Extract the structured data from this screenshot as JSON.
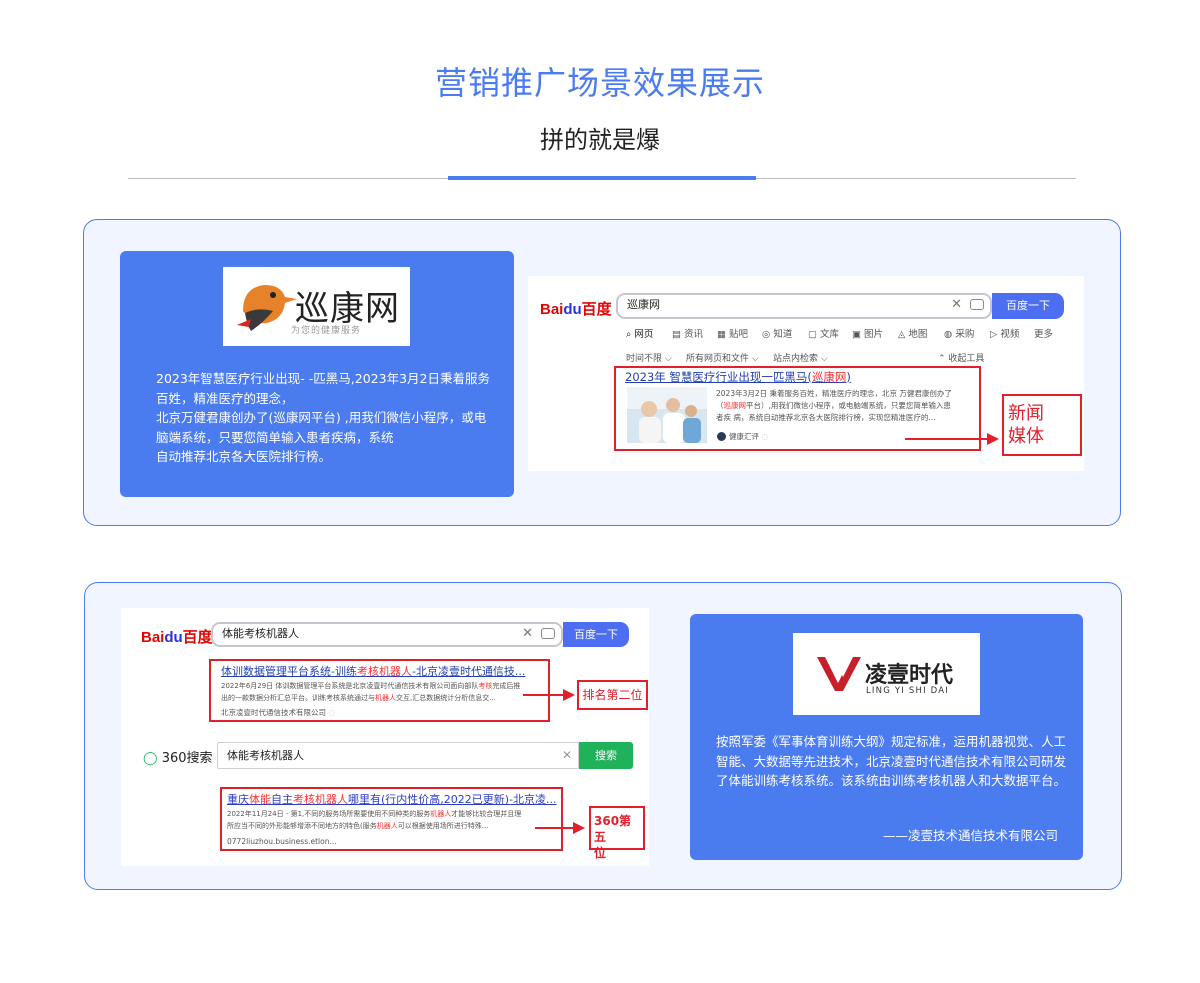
{
  "header": {
    "title": "营销推广场景效果展示",
    "subtitle": "拼的就是爆"
  },
  "case1": {
    "logo_text": "巡康网",
    "logo_slogan": "为您的健康服务",
    "desc_lines": [
      "2023年智慧医疗行业出现- -匹黑马,2023年3月2日秉着服务",
      "百姓，精准医疗的理念，",
      "北京万健君康创办了(巡康网平台) ,用我们微信小程序，或电",
      "脑端系统，只要您简单输入患者疾病，系统",
      "自动推荐北京各大医院排行榜。"
    ],
    "screenshot": {
      "engine_logo_a": "Bai",
      "engine_logo_b": "du",
      "engine_logo_c": "百度",
      "query": "巡康网",
      "search_button": "百度一下",
      "tabs": [
        "网页",
        "资讯",
        "贴吧",
        "知道",
        "文库",
        "图片",
        "地图",
        "采购",
        "视频",
        "更多"
      ],
      "filters": [
        "时间不限",
        "所有网页和文件",
        "站点内检索"
      ],
      "tools": "收起工具",
      "result_title_a": "2023年 智慧医疗行业出现一匹黑马(",
      "result_title_hl": "巡康网",
      "result_title_b": ")",
      "snippet_l1": "2023年3月2日 秉着服务百姓，精准医疗的理念，北京 万健君康创办了",
      "snippet_l2a": "（",
      "snippet_l2hl": "巡康网",
      "snippet_l2b": "平台）,用我们微信小程序，或电脑端系统，只要您简单输入患",
      "snippet_l3": "者疾 病，系统自动推荐北京各大医院排行榜，实现您精准医疗的...",
      "source": "健康汇评",
      "label": "新闻媒体",
      "label_l1": "新闻",
      "label_l2": "媒体"
    }
  },
  "case2": {
    "logo_text": "凌壹时代",
    "logo_sub": "LING YI SHI DAI",
    "desc_lines": [
      "按照军委《军事体育训练大纲》规定标准，运用机器视觉、人工",
      "智能、大数据等先进技术，北京凌壹时代通信技术有限公司研发",
      "了体能训练考核系统。该系统由训练考核机器人和大数据平台。"
    ],
    "signature": "——凌壹技术通信技术有限公司",
    "baidu": {
      "engine_logo_a": "Bai",
      "engine_logo_b": "du",
      "engine_logo_c": "百度",
      "query": "体能考核机器人",
      "search_button": "百度一下",
      "result_title_a": "体训数据管理平台系统-训练",
      "result_title_hl": "考核机器人",
      "result_title_b": "-北京凌壹时代通信技...",
      "snippet_l1a": "2022年6月29日 体训数据管理平台系统是北京凌壹时代通信技术有限公司面向部队",
      "snippet_l1hl": "考核",
      "snippet_l1b": "完成后推",
      "snippet_l2a": "出的一款数据分析汇总平台。训练考核系统通过与",
      "snippet_l2hl": "机器人",
      "snippet_l2b": "交互,汇总数据统计分析信息交...",
      "source": "北京凌壹时代通信技术有限公司",
      "label": "排名第二位"
    },
    "so360": {
      "engine_logo": "360搜索",
      "query": "体能考核机器人",
      "search_button": "搜索",
      "result_title_a": "重庆",
      "result_title_hl1": "体能",
      "result_title_b": "自主",
      "result_title_hl2": "考核机器人",
      "result_title_c": "哪里有(行内性价高,2022已更新)-北京凌...",
      "snippet_l1a": "2022年11月24日 - 第1,不同的服务场所需要使用不同种类的服务",
      "snippet_l1hl": "机器人",
      "snippet_l1b": "才能够比较合理并且理",
      "snippet_l2a": "所应当不同的外形能够增添不同地方的特色(服务",
      "snippet_l2hl": "机器人",
      "snippet_l2b": "可以根据使用场所进行特殊...",
      "source": "0772liuzhou.business.etlon...",
      "label_l1": "360第五",
      "label_l2": "位"
    }
  },
  "colors": {
    "accent": "#4a7bef",
    "panel_bg": "#f1f5ff",
    "highlight_red": "#e0202a",
    "baidu_blue": "#4e6ef2",
    "so360_green": "#1fb25a"
  }
}
